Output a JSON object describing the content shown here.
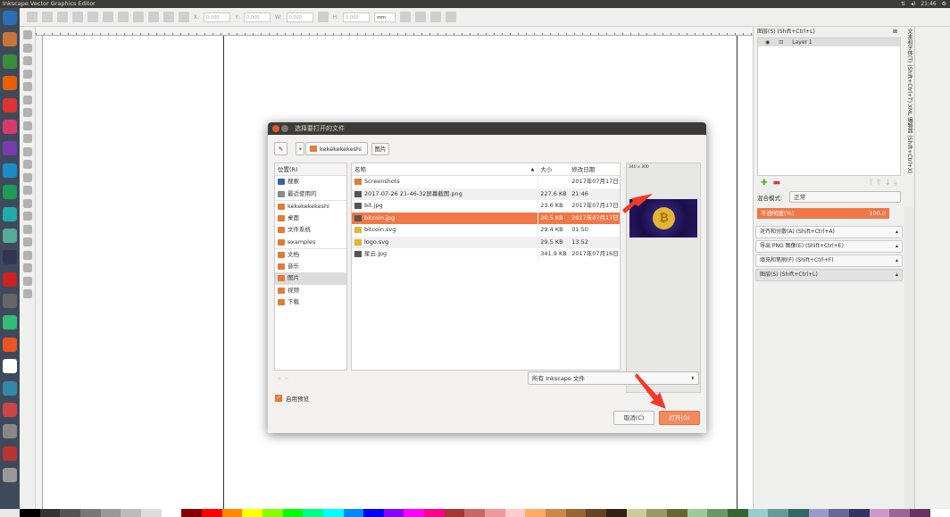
{
  "window": {
    "title": "Inkscape Vector Graphics Editor"
  },
  "tray": {
    "clock": "21:46"
  },
  "toolbar": {
    "x_label": "X:",
    "y_label": "Y:",
    "w_label": "W:",
    "h_label": "H:",
    "x": "0.000",
    "y": "0.000",
    "w": "0.000",
    "h": "0.000",
    "unit": "mm"
  },
  "dock": {
    "layers_title": "图层(S) (Shift+Ctrl+L)",
    "layer_name": "Layer 1",
    "blend_label": "混合模式:",
    "blend_value": "正常",
    "opacity_label": "不透明度(%)",
    "opacity_value": "100.0",
    "opacity_percent": 100,
    "panels": [
      "对齐和分散(A) (Shift+Ctrl+A)",
      "导出 PNG 图像(E) (Shift+Ctrl+E)",
      "填充和笔刷(F) (Shift+Ctrl+F)",
      "图层(S) (Shift+Ctrl+L)"
    ],
    "vertical_tabs": [
      "文本和字体(T) (Shift+Ctrl+T)",
      "XML 编辑器 (Shift+Ctrl+X)"
    ]
  },
  "dialog": {
    "title": "选择要打开的文件",
    "path": [
      "kekekekekeshi",
      "图片"
    ],
    "places_header": "位置(R)",
    "places": [
      "搜索",
      "最近使用的",
      "kekekekekeshi",
      "桌面",
      "文件系统",
      "examples",
      "文档",
      "音乐",
      "图片",
      "视频",
      "下载"
    ],
    "selected_place": "图片",
    "columns": [
      "名称",
      "大小",
      "修改日期"
    ],
    "files": [
      {
        "name": "Screenshots",
        "size": "",
        "date": "2017年07月17日",
        "type": "folder"
      },
      {
        "name": "2017-07-26 21-46-32屏幕截图.png",
        "size": "227.6 KB",
        "date": "21:46",
        "type": "image"
      },
      {
        "name": "bit.jpg",
        "size": "23.6 KB",
        "date": "2017年07月17日",
        "type": "image"
      },
      {
        "name": "bitcoin.jpg",
        "size": "20.5 KB",
        "date": "2017年07月17日",
        "type": "image",
        "selected": true
      },
      {
        "name": "bitcoin.svg",
        "size": "29.4 KB",
        "date": "01:50",
        "type": "svg"
      },
      {
        "name": "logo.svg",
        "size": "29.5 KB",
        "date": "13:52",
        "type": "svg"
      },
      {
        "name": "星云.jpg",
        "size": "341.9 KB",
        "date": "2017年07月16日",
        "type": "image"
      }
    ],
    "preview_size": "340 x 300",
    "filter": "所有 Inkscape 文件",
    "enable_preview": "启用预览",
    "cancel": "取消(C)",
    "open": "打开(O)",
    "accent": "#f07746"
  }
}
